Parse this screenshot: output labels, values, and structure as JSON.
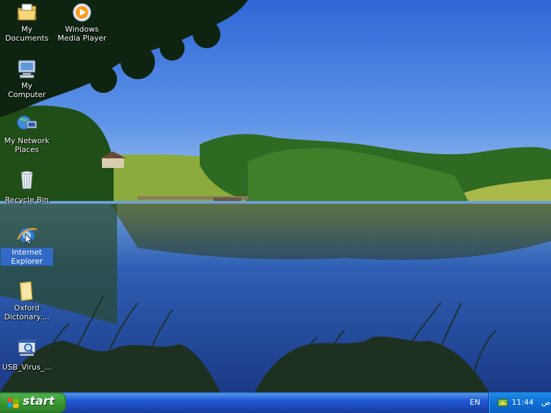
{
  "desktop": {
    "icons": [
      {
        "label": "My Documents",
        "icon": "folder-documents-icon",
        "selected": false
      },
      {
        "label": "Windows Media Player",
        "icon": "media-player-icon",
        "selected": false
      },
      {
        "label": "My Computer",
        "icon": "computer-icon",
        "selected": false
      },
      {
        "label": "My Network Places",
        "icon": "network-icon",
        "selected": false
      },
      {
        "label": "Recycle Bin",
        "icon": "recycle-bin-icon",
        "selected": false
      },
      {
        "label": "Internet Explorer",
        "icon": "internet-explorer-icon",
        "selected": true
      },
      {
        "label": "Oxford Dictonary....",
        "icon": "folder-icon",
        "selected": false
      },
      {
        "label": "USB_Virus_...",
        "icon": "usb-program-icon",
        "selected": false
      }
    ]
  },
  "taskbar": {
    "start_label": "start",
    "language": "EN",
    "clock": "11:44",
    "ampm": "ص"
  },
  "colors": {
    "taskbar_blue": "#245edb",
    "start_green": "#3c9a3a",
    "tray_blue": "#0f6fd8",
    "selection_blue": "#3169c6"
  }
}
